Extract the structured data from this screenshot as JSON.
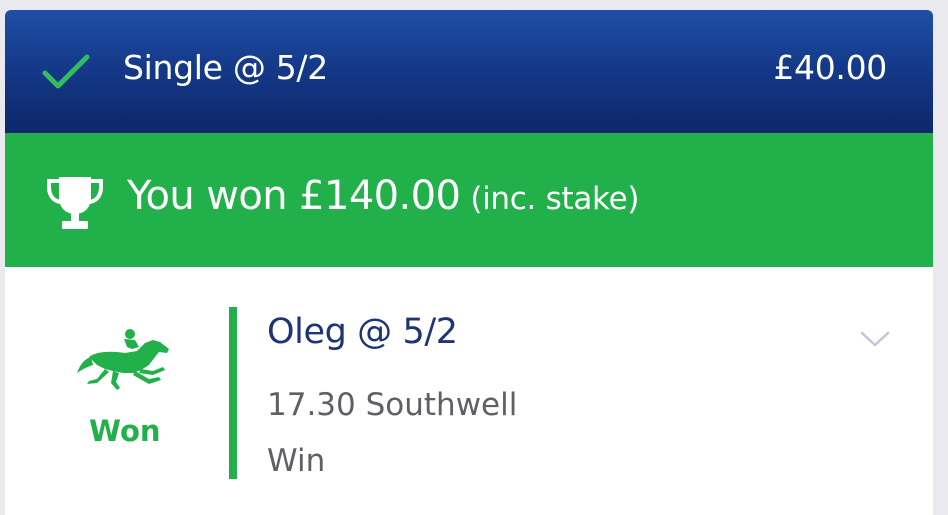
{
  "header": {
    "bet_type": "Single @ 5/2",
    "stake": "£40.00",
    "icon": "check-icon"
  },
  "banner": {
    "icon": "trophy-icon",
    "main": "You won £140.00",
    "sub": "(inc. stake)"
  },
  "leg": {
    "icon": "horse-racing-icon",
    "result": "Won",
    "selection": "Oleg @ 5/2",
    "race": "17.30 Southwell",
    "market": "Win",
    "expand_icon": "chevron-down-icon"
  },
  "colors": {
    "header_top": "#1f4fa6",
    "header_bottom": "#0d276a",
    "win_green": "#22b04b",
    "check_green": "#2fbf5b",
    "selection_navy": "#1e3575",
    "secondary_text": "#5f5f66",
    "chevron": "#c3c6d6"
  }
}
